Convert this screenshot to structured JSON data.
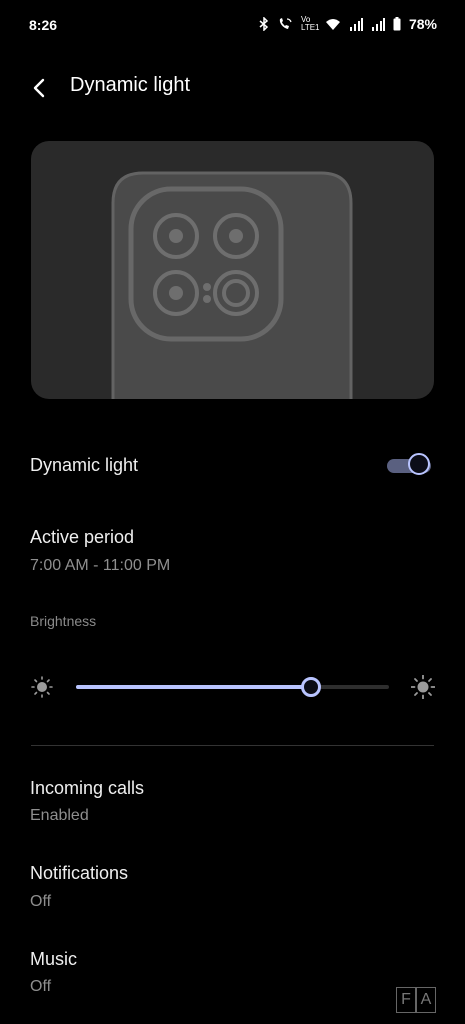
{
  "status_bar": {
    "time": "8:26",
    "network_label": "Vo LTE1",
    "battery_percent": "78%",
    "icons": [
      "bluetooth-icon",
      "wifi-call-icon",
      "wifi-icon",
      "signal-icon",
      "signal-icon",
      "battery-icon"
    ]
  },
  "header": {
    "title": "Dynamic light"
  },
  "settings": {
    "dynamic_light": {
      "label": "Dynamic light",
      "enabled": true
    },
    "active_period": {
      "label": "Active period",
      "value": "7:00 AM - 11:00 PM"
    },
    "brightness": {
      "section_label": "Brightness",
      "level": 0.75
    },
    "incoming_calls": {
      "label": "Incoming calls",
      "value": "Enabled"
    },
    "notifications": {
      "label": "Notifications",
      "value": "Off"
    },
    "music": {
      "label": "Music",
      "value": "Off"
    }
  },
  "watermark": {
    "left": "F",
    "right": "A"
  },
  "colors": {
    "accent": "#b9c4ff",
    "track_on": "#5a6080",
    "background": "#000000"
  }
}
